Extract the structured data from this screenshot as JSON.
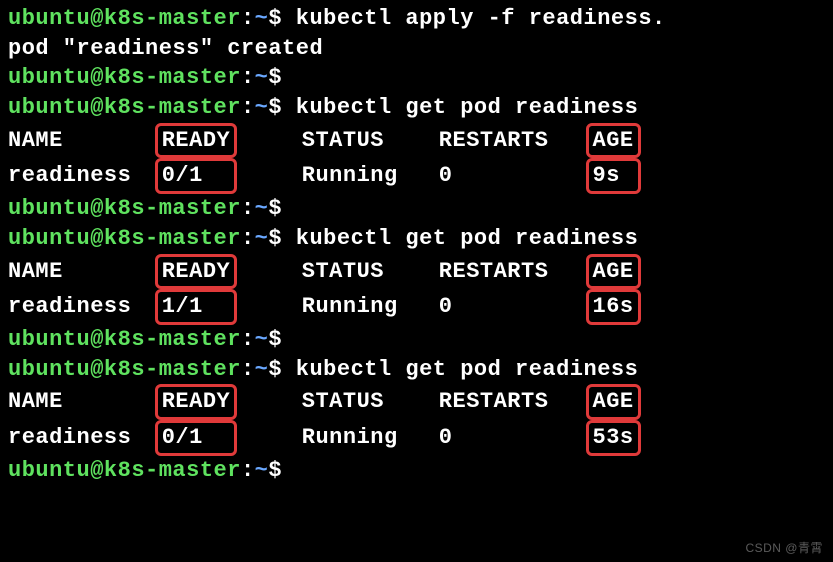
{
  "prompt": {
    "user": "ubuntu",
    "at": "@",
    "host": "k8s-master",
    "colon": ":",
    "tilde": "~",
    "dollar": "$"
  },
  "cmd1": "kubectl apply -f readiness.",
  "out1": "pod \"readiness\" created",
  "cmd2": "kubectl get pod readiness",
  "table": {
    "name_h": "NAME",
    "ready_h": "READY",
    "status_h": "STATUS",
    "restarts_h": "RESTARTS",
    "age_h": "AGE",
    "row": {
      "name": "readiness",
      "status": "Running",
      "restarts": "0",
      "ready1": "0/1",
      "age1": "9s",
      "ready2": "1/1",
      "age2": "16s",
      "ready3": "0/1",
      "age3": "53s"
    }
  },
  "watermark": "CSDN @青霄"
}
